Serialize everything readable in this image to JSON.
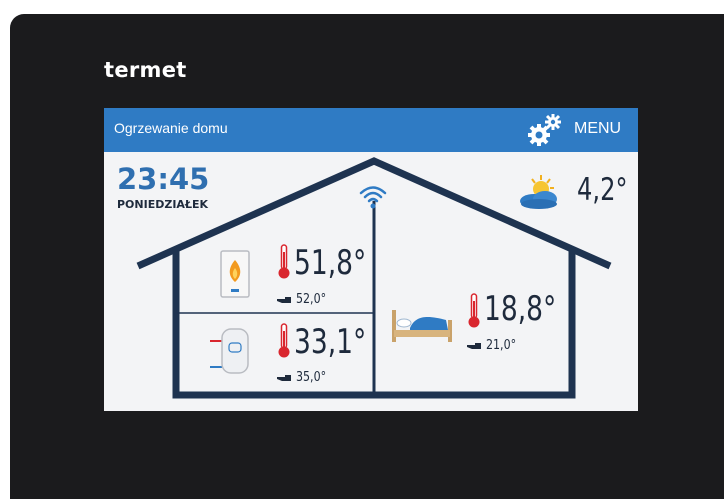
{
  "brand": "termet",
  "header": {
    "title": "Ogrzewanie domu",
    "menu_label": "MENU"
  },
  "clock": {
    "time": "23:45",
    "day": "PONIEDZIAŁEK"
  },
  "weather": {
    "icon": "partly-sunny-cloud-icon",
    "outside_temp": "4,2°"
  },
  "boiler": {
    "icon": "boiler-flame-icon",
    "current_temp": "51,8°",
    "set_temp": "52,0°"
  },
  "hot_water": {
    "icon": "water-tank-icon",
    "current_temp": "33,1°",
    "set_temp": "35,0°"
  },
  "room": {
    "icon": "bed-icon",
    "current_temp": "18,8°",
    "set_temp": "21,0°"
  },
  "colors": {
    "header_blue": "#2f7bc4",
    "house_outline": "#1e3350",
    "thermometer_red": "#d9262e",
    "bezel": "#1b1b1d"
  }
}
